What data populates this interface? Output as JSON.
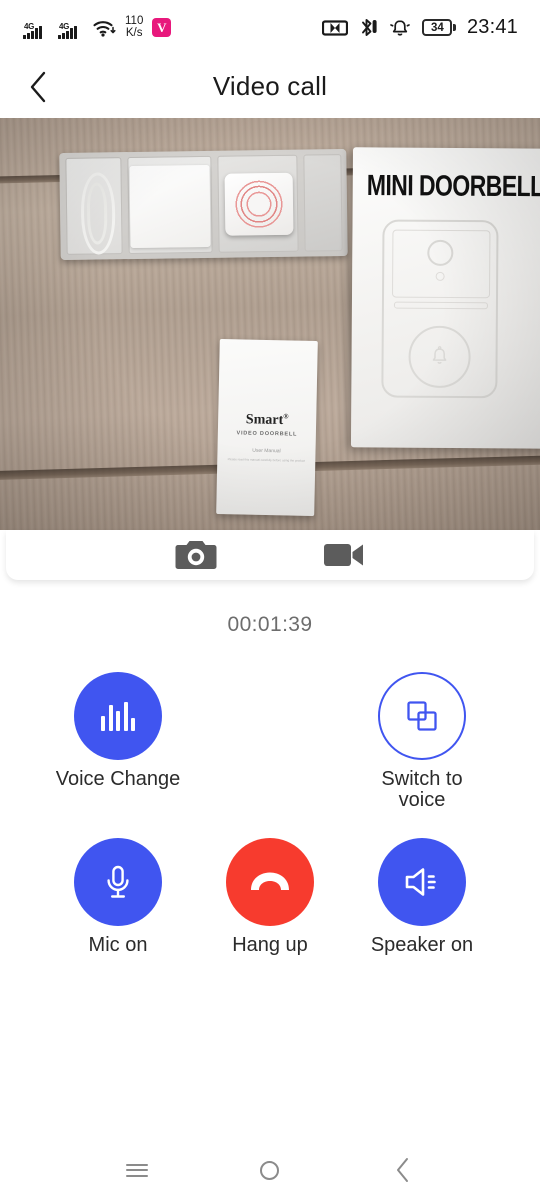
{
  "status_bar": {
    "network_1": "4G",
    "network_2": "4G",
    "net_speed_value": "110",
    "net_speed_unit": "K/s",
    "app_badge_glyph": "V",
    "battery_level": "34",
    "clock": "23:41",
    "icons": [
      "signal-4g-icon",
      "signal-4g-icon",
      "wifi-icon",
      "network-speed-icon",
      "app-badge-icon",
      "vr-glasses-icon",
      "bluetooth-icon",
      "alarm-bell-icon",
      "battery-icon"
    ]
  },
  "header": {
    "title": "Video call",
    "back_icon": "chevron-left-icon"
  },
  "video": {
    "alt_description": "MINI DOORBELL retail box and accessories on wooden surface",
    "retail_box_title": "MINI DOORBELL",
    "booklet_brand": "Smart",
    "booklet_brand_mark": "®",
    "booklet_sub": "VIDEO DOORBELL",
    "booklet_sub2": "User Manual",
    "booklet_fine": "Please read this manual carefully before using the product"
  },
  "capture_bar": {
    "screenshot_label": "camera-icon",
    "record_label": "video-camera-icon"
  },
  "call": {
    "duration": "00:01:39"
  },
  "controls": {
    "row1": [
      {
        "name": "voice-change",
        "label": "Voice Change",
        "icon": "equalizer-icon",
        "style": "filled-blue",
        "color": "#4055F0"
      },
      {
        "name": "switch-to-voice",
        "label": "Switch to voice",
        "icon": "swap-squares-icon",
        "style": "outline-blue",
        "color": "#4055F0"
      }
    ],
    "row2": [
      {
        "name": "mic-toggle",
        "label": "Mic on",
        "icon": "microphone-icon",
        "style": "filled-blue",
        "color": "#4055F0"
      },
      {
        "name": "hang-up",
        "label": "Hang up",
        "icon": "phone-hangup-icon",
        "style": "filled-red",
        "color": "#F73B2E"
      },
      {
        "name": "speaker-toggle",
        "label": "Speaker on",
        "icon": "speaker-icon",
        "style": "filled-blue",
        "color": "#4055F0"
      }
    ]
  },
  "nav_bar": {
    "recents_icon": "menu-icon",
    "home_icon": "circle-home-icon",
    "back_icon": "chevron-left-icon"
  }
}
